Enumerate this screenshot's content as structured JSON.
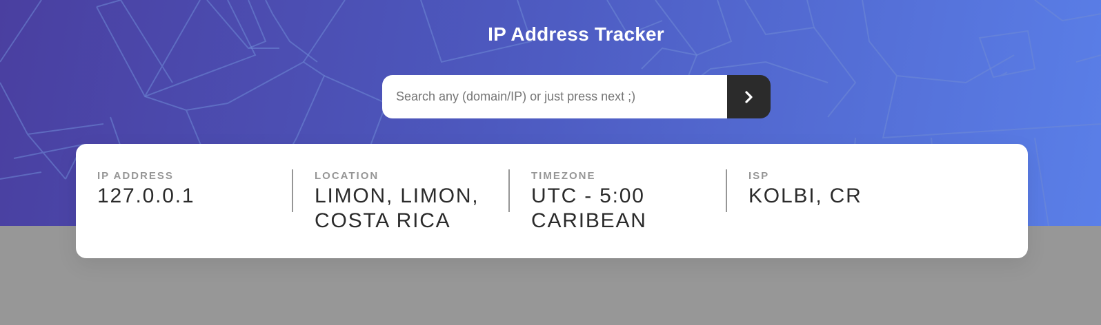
{
  "header": {
    "title": "IP Address Tracker"
  },
  "search": {
    "placeholder": "Search any (domain/IP) or just press next ;)",
    "value": "",
    "submit_icon": "chevron-right-icon"
  },
  "info": {
    "ip": {
      "label": "IP ADDRESS",
      "value": "127.0.0.1"
    },
    "location": {
      "label": "LOCATION",
      "value": "LIMON, LIMON, COSTA RICA"
    },
    "timezone": {
      "label": "TIMEZONE",
      "value": "UTC - 5:00 CARIBEAN"
    },
    "isp": {
      "label": "ISP",
      "value": "KOLBI, CR"
    }
  },
  "colors": {
    "hero_gradient_start": "#4a3fa0",
    "hero_gradient_end": "#5a7fe8",
    "map_placeholder": "#979797",
    "button": "#2b2b2b",
    "label": "#969696",
    "value": "#2b2b2b"
  }
}
